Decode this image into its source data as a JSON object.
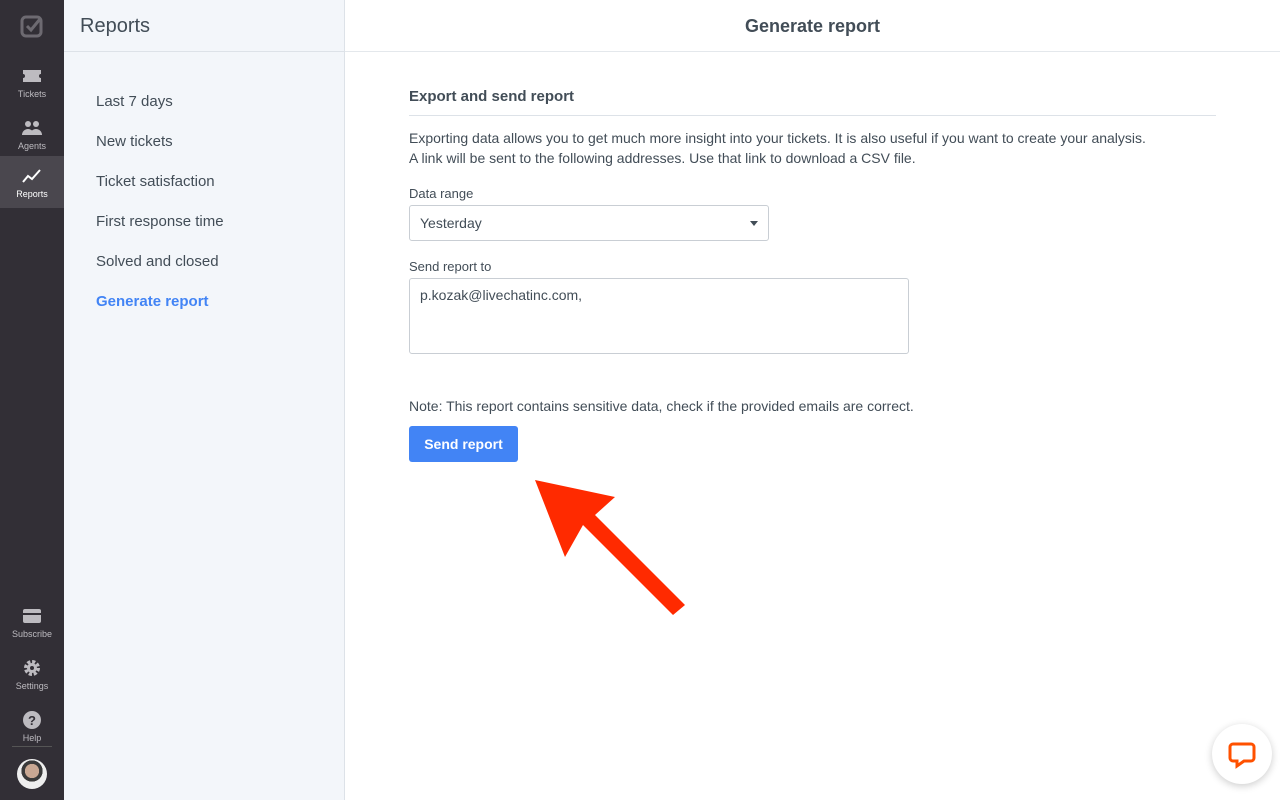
{
  "rail": {
    "items": [
      {
        "label": "Tickets"
      },
      {
        "label": "Agents"
      },
      {
        "label": "Reports"
      },
      {
        "label": "Subscribe"
      },
      {
        "label": "Settings"
      },
      {
        "label": "Help"
      }
    ],
    "active": "Reports"
  },
  "sidebar": {
    "title": "Reports",
    "items": [
      {
        "label": "Last 7 days"
      },
      {
        "label": "New tickets"
      },
      {
        "label": "Ticket satisfaction"
      },
      {
        "label": "First response time"
      },
      {
        "label": "Solved and closed"
      },
      {
        "label": "Generate report"
      }
    ],
    "active": "Generate report"
  },
  "main": {
    "title": "Generate report",
    "section_title": "Export and send report",
    "description_1": "Exporting data allows you to get much more insight into your tickets. It is also useful if you want to create your analysis.",
    "description_2": "A link will be sent to the following addresses. Use that link to download a CSV file.",
    "data_range_label": "Data range",
    "data_range_value": "Yesterday",
    "send_to_label": "Send report to",
    "send_to_value": "p.kozak@livechatinc.com,",
    "note": "Note: This report contains sensitive data, check if the provided emails are correct.",
    "send_button": "Send report"
  },
  "colors": {
    "accent": "#4284f5",
    "rail": "#322f36",
    "annotation": "#ff2a00",
    "chat": "#ff5100"
  }
}
